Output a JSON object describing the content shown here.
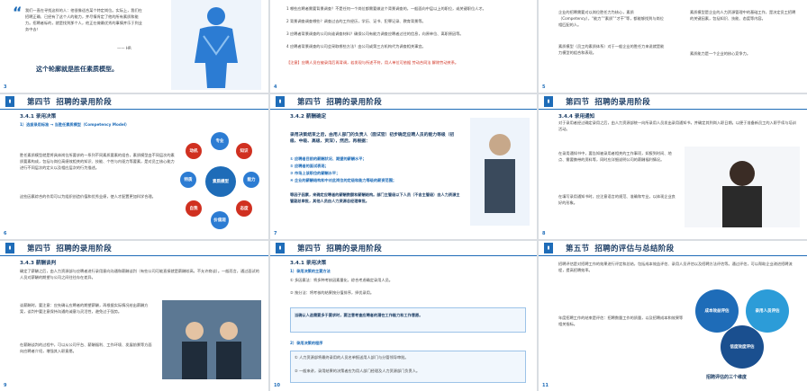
{
  "slides": {
    "s1": {
      "quote": "我们一直在寻找这样的人：他很像适合某个特定岗位。实际上，我们在招聘正确、已经有了这个人的能力，并尽情肯定了他的所有素质和能力。招聘者标的，就是找到那个人，他正在做最优秀的事情并乐于到业务中去！",
      "quote_by": "—— HR",
      "footer": "这个轮廓就是胜任素质模型。"
    },
    "s2": {
      "items": [
        "1 哪些应聘者需要背景调查？不是任何一个岗位都需要做这个背景调查的，一般面向中层以上的职位，或关键职位人才。",
        "2 背景调查调查哪些？调查过去的工作经历，学历、证书、犯罪记录、教育背景等。",
        "3 应聘者背景调查的公司向谁调查材料？确保公司有能力调查应聘者过往的信息，向原单位、离职原因等。",
        "4 应聘者背景调查的公司会采取哪些方法？由公司或第三方机构代为调查相关事宜。"
      ],
      "note": "【注意】应聘人员在被录用后再背调，若发现与所述不符，用人单位可依据 劳动合同法 解除劳动关系。"
    },
    "s3": {
      "text1": "企业的招聘需要对以岗位胜任力为核心，素质（Competency），“能力”“素质”“才干”等，都能够找到与岗位相匹配的人。",
      "text2": "素质模型（员工的素质体系）对于一般企业的胜任力来说就是能力模型的组合和表现。",
      "text3": "素质模型是企业的人力资源管理中的基础工作，是决定员工招聘的关键因素，包括知识、技能、态度等内容。",
      "text4": "素质能力是一个企业的核心竞争力。"
    },
    "s4": {
      "section": "第四节",
      "title": "招聘的录用阶段",
      "sub": "3.4.1 录用决策",
      "line": "1）选拔录用标准 → 当胜任素质模型（Competency Model）",
      "para1": "胜任素质模型就是将具体岗位所要求的一系列不同素质要素的组合，素质模型由不同层次的素质要素构成，包括与岗位高绩效相关的知识、技能、个性与内驱力等要素，是对员工核心能力进行不同层次的定义以及相应层次的行为描述。",
      "para2": "这些因素综合的作用可以为组织创造价值和优秀业绩，使人才配置更加科学合理。",
      "wheel_center": "素质模型",
      "wheel": [
        "专业",
        "知识",
        "能力",
        "态度",
        "价值观",
        "自我",
        "特质",
        "动机"
      ]
    },
    "s5": {
      "section": "第四节",
      "title": "招聘的录用阶段",
      "sub": "3.4.2 薪酬确定",
      "intro": "录用决策结束之后，由用人部门的负责人（面试官）初步确定应聘人员的能力等级（初级、中级、高级、资深），然后，再根据：",
      "items": [
        "① 应聘者目前的薪酬状况、期望的薪酬水平；",
        "② 应聘者的面试表现；",
        "③ 市场上该职位的薪酬水平；",
        "④ 企业的薪酬结构和中对此岗位的定级和能力等级的薪资范围；"
      ],
      "outro": "等因子因素，来确定应聘者的薪酬数额和薪酬结构。部门主管级以下人员（不含主管级）由人力资源主管副总审批，其他人员由人力资源总经理审批。"
    },
    "s6": {
      "section": "第四节",
      "title": "招聘的录用阶段",
      "sub": "3.4.4 录用通知",
      "para1": "对于录用者经过确定录用之后，由人力资源部统一向所录用人员发出录用通知书，并确定其到岗入职日期。以便于准备新员工的入职手续与培训活动。",
      "para2": "在录用通知书中，要告知被录用者相关的工作事项，如报到时间、地点、需要携带的资料等，同时应详细说明公司的薪酬福利情况。",
      "para3": "在填写录用通知书时，应注意语言的规范、准确和专业，以体现企业良好的形象。"
    },
    "s7": {
      "section": "第四节",
      "title": "招聘的录用阶段",
      "sub": "3.4.3 薪酬谈判",
      "para1": "确定了薪酬之后，由人力资源部与应聘者进行录用意向沟通和薪酬谈判（有些公司可能直接就是薪酬较高，不允许商谈）。一般而言，通过面试的人员对薪酬的期望与公司之间往往存在差异。",
      "para2": "谈薪酬时，要注意：应先确认应聘者的期望薪酬，再根据实际情况给出薪酬方案，谈判中要注意保持沟通的诚意与灵活性，避免过于强势。",
      "para3": "在薪酬谈判的过程中，可以从公司平台、薪酬福利、工作环境、发展前景等方面向应聘者介绍，增强其入职意愿。"
    },
    "s8": {
      "section": "第四节",
      "title": "招聘的录用阶段",
      "sub": "3.4.1 录用决策",
      "h1": "1）录用决策的主要方法",
      "m1": "① 多因素法：将多种考核因素量化，综合考虑确定录用人员。",
      "m2": "② 按分法：将考核的结果按分值排序，择优录用。",
      "highlight": "当确认人选需要多于要求时，要注意考查应聘者的潜在工作能力和工作意愿。",
      "h2": "2）录用决策的程序",
      "p1": "① 人力资源部将最终录用的人员名单报送用人部门与分管领导审批。",
      "p2": "② 一般来讲，录用结果的决策者应为用人部门经理及人力资源部门负责人。"
    },
    "s9": {
      "section": "第五节",
      "title": "招聘的评估与总结阶段",
      "para1": "招聘评估是对招聘工作的效果进行评定和总结，包括成本效益评估、录用人员评估以及招聘方法评估等。通过评估，可以帮助企业改进招聘流程，提高招聘效率。",
      "para2": "年度招聘工作的结束是评估：招聘数量工作的质量，以及招聘成本和效果等相关指标。",
      "circles": [
        "成本效益评估",
        "录用人员评估",
        "信度效度评估"
      ],
      "caption": "招聘评估的三个维度"
    }
  },
  "page_numbers": [
    "3",
    "4",
    "5",
    "6",
    "7",
    "8",
    "9",
    "10",
    "11"
  ]
}
